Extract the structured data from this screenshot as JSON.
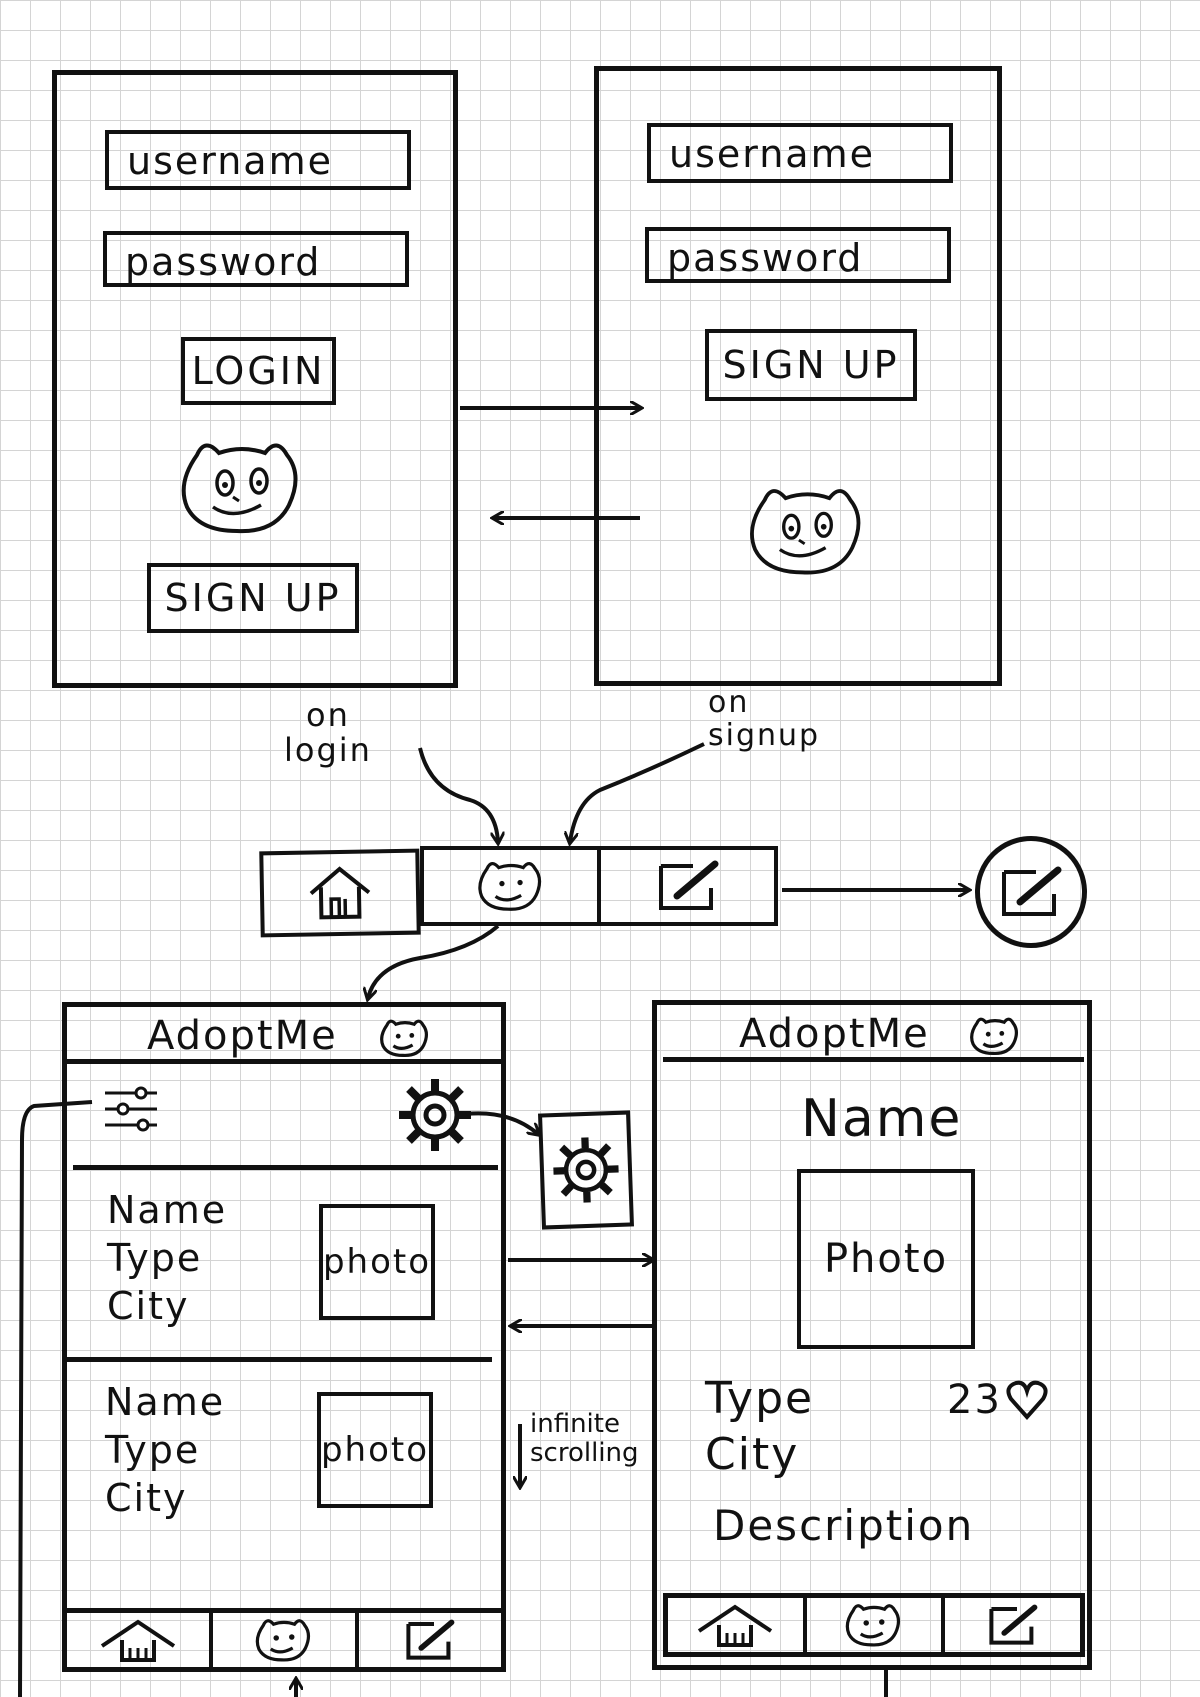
{
  "login_screen": {
    "username_placeholder": "username",
    "password_placeholder": "password",
    "login_label": "LOGIN",
    "signup_label": "SIGN UP"
  },
  "signup_screen": {
    "username_placeholder": "username",
    "password_placeholder": "password",
    "signup_label": "SIGN UP"
  },
  "transitions": {
    "on_login": "on\nlogin",
    "on_signup": "on\nsignup"
  },
  "list_screen": {
    "app_title": "AdoptMe",
    "items": [
      {
        "name": "Name",
        "type": "Type",
        "city": "City",
        "photo": "photo"
      },
      {
        "name": "Name",
        "type": "Type",
        "city": "City",
        "photo": "photo"
      }
    ],
    "scroll_note": "infinite\nscrolling"
  },
  "detail_screen": {
    "app_title": "AdoptMe",
    "name": "Name",
    "photo": "Photo",
    "type": "Type",
    "likes": "23",
    "city": "City",
    "description": "Description"
  },
  "icons": [
    "bear-face-icon",
    "home-icon",
    "edit-icon",
    "gear-icon",
    "filter-sliders-icon",
    "heart-icon"
  ],
  "colors": {
    "ink": "#111111",
    "grid": "#d4d4d4",
    "paper": "#ffffff"
  }
}
